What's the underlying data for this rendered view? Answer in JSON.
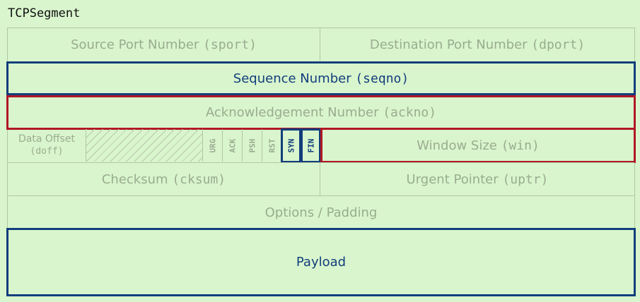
{
  "title": "TCPSegment",
  "fields": {
    "sport": {
      "label": "Source Port Number",
      "code": "(sport)"
    },
    "dport": {
      "label": "Destination Port Number",
      "code": "(dport)"
    },
    "seqno": {
      "label": "Sequence Number",
      "code": "(seqno)"
    },
    "ackno": {
      "label": "Acknowledgement Number",
      "code": "(ackno)"
    },
    "doff": {
      "label": "Data Offset",
      "code": "(doff)"
    },
    "win": {
      "label": "Window Size",
      "code": "(win)"
    },
    "cksum": {
      "label": "Checksum",
      "code": "(cksum)"
    },
    "uptr": {
      "label": "Urgent Pointer",
      "code": "(uptr)"
    },
    "options": {
      "label": "Options / Padding"
    },
    "payload": {
      "label": "Payload"
    }
  },
  "flags": [
    "URG",
    "ACK",
    "PSH",
    "RST",
    "SYN",
    "FIN"
  ],
  "highlighted_flags": [
    "SYN",
    "FIN"
  ],
  "colors": {
    "background": "#d9f5cd",
    "highlight_blue": "#123e7c",
    "highlight_red": "#b01826",
    "muted_text": "#9aac90"
  }
}
